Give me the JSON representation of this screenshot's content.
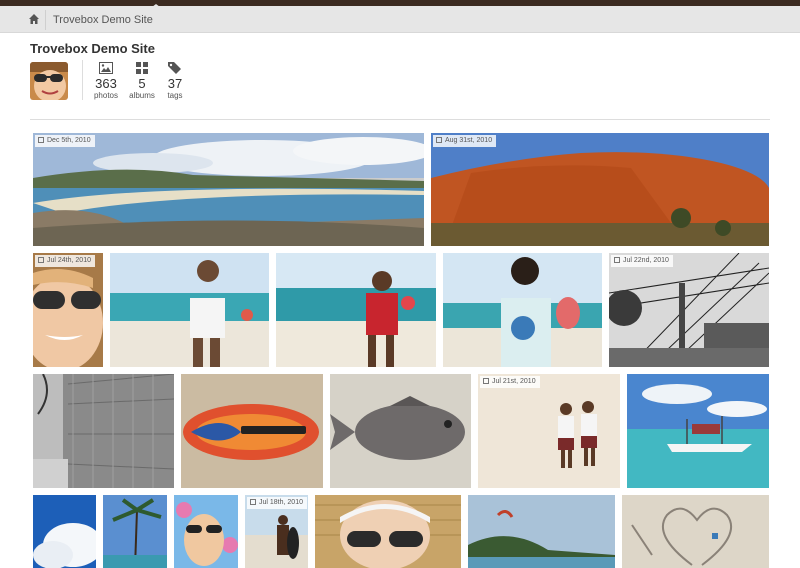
{
  "navbar": {
    "home_icon": "home-icon",
    "link": "Trovebox Demo Site"
  },
  "profile": {
    "title": "Trovebox Demo Site",
    "stats": [
      {
        "icon": "image-icon",
        "count": "363",
        "label": "photos"
      },
      {
        "icon": "grid-icon",
        "count": "5",
        "label": "albums"
      },
      {
        "icon": "tag-icon",
        "count": "37",
        "label": "tags"
      }
    ]
  },
  "photos": {
    "p1": {
      "date": "Dec 5th, 2010"
    },
    "p2": {
      "date": "Aug 31st, 2010"
    },
    "p3": {
      "date": "Jul 24th, 2010"
    },
    "p7": {
      "date": "Jul 22nd, 2010"
    },
    "p11": {
      "date": "Jul 21st, 2010"
    },
    "p16": {
      "date": "Jul 18th, 2010"
    }
  },
  "colors": {
    "top_strip": "#3b2a20",
    "navbar_bg": "#e6e6e6"
  }
}
